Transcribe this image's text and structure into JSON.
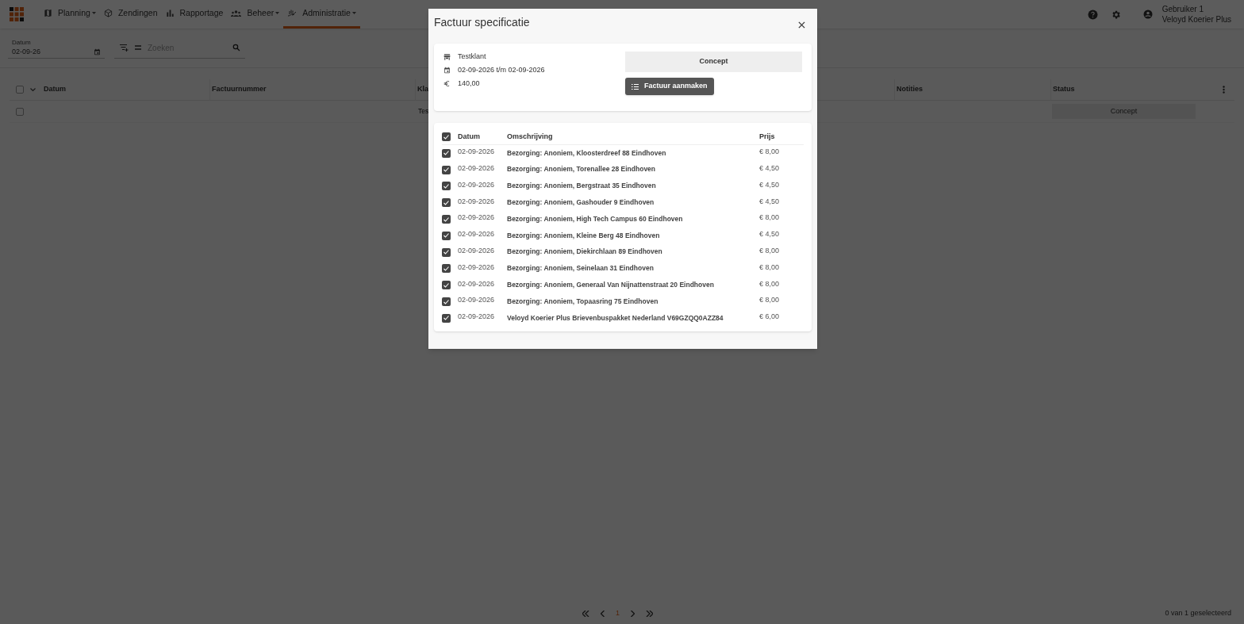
{
  "nav": {
    "items": [
      {
        "kind": "map",
        "label": "Planning",
        "dropdown": true,
        "selected": false
      },
      {
        "kind": "box",
        "label": "Zendingen",
        "dropdown": false,
        "selected": false
      },
      {
        "kind": "chart",
        "label": "Rapportage",
        "dropdown": false,
        "selected": false
      },
      {
        "kind": "people",
        "label": "Beheer",
        "dropdown": true,
        "selected": false
      },
      {
        "kind": "hand",
        "label": "Administratie",
        "dropdown": true,
        "selected": true
      }
    ],
    "user": {
      "name": "Gebruiker 1",
      "company": "Veloyd Koerier Plus"
    }
  },
  "filters": {
    "date_label": "Datum",
    "date_value": "02-09-26",
    "search_placeholder": "Zoeken"
  },
  "table": {
    "all_selected": false,
    "columns": [
      "Datum",
      "Factuurnummer",
      "Kla",
      "Notities",
      "Status"
    ],
    "rows": [
      {
        "selected": false,
        "customer": "Tes",
        "status": "Concept"
      }
    ]
  },
  "pagination": {
    "page": "1",
    "selection_text": "0 van 1 geselecteerd"
  },
  "dialog": {
    "title": "Factuur specificatie",
    "customer": "Testklant",
    "period": "02-09-2026 t/m 02-09-2026",
    "amount": "140,00",
    "status": "Concept",
    "create_button": "Factuur aanmaken",
    "table": {
      "all_checked": true,
      "columns": [
        "Datum",
        "Omschrijving",
        "Prijs"
      ],
      "rows": [
        {
          "checked": true,
          "date": "02-09-2026",
          "description": "Bezorging: Anoniem, Kloosterdreef 88 Eindhoven",
          "price": "€ 8,00"
        },
        {
          "checked": true,
          "date": "02-09-2026",
          "description": "Bezorging: Anoniem, Torenallee 28 Eindhoven",
          "price": "€ 4,50"
        },
        {
          "checked": true,
          "date": "02-09-2026",
          "description": "Bezorging: Anoniem, Bergstraat 35 Eindhoven",
          "price": "€ 4,50"
        },
        {
          "checked": true,
          "date": "02-09-2026",
          "description": "Bezorging: Anoniem, Gashouder 9 Eindhoven",
          "price": "€ 4,50"
        },
        {
          "checked": true,
          "date": "02-09-2026",
          "description": "Bezorging: Anoniem, High Tech Campus 60 Eindhoven",
          "price": "€ 8,00"
        },
        {
          "checked": true,
          "date": "02-09-2026",
          "description": "Bezorging: Anoniem, Kleine Berg 48 Eindhoven",
          "price": "€ 4,50"
        },
        {
          "checked": true,
          "date": "02-09-2026",
          "description": "Bezorging: Anoniem, Diekirchlaan 89 Eindhoven",
          "price": "€ 8,00"
        },
        {
          "checked": true,
          "date": "02-09-2026",
          "description": "Bezorging: Anoniem, Seinelaan 31 Eindhoven",
          "price": "€ 8,00"
        },
        {
          "checked": true,
          "date": "02-09-2026",
          "description": "Bezorging: Anoniem, Generaal Van Nijnattenstraat 20 Eindhoven",
          "price": "€ 8,00"
        },
        {
          "checked": true,
          "date": "02-09-2026",
          "description": "Bezorging: Anoniem, Topaasring 75 Eindhoven",
          "price": "€ 8,00"
        },
        {
          "checked": true,
          "date": "02-09-2026",
          "description": "Veloyd Koerier Plus Brievenbuspakket Nederland V69GZQQ0AZZ84",
          "price": "€ 6,00"
        }
      ]
    }
  }
}
